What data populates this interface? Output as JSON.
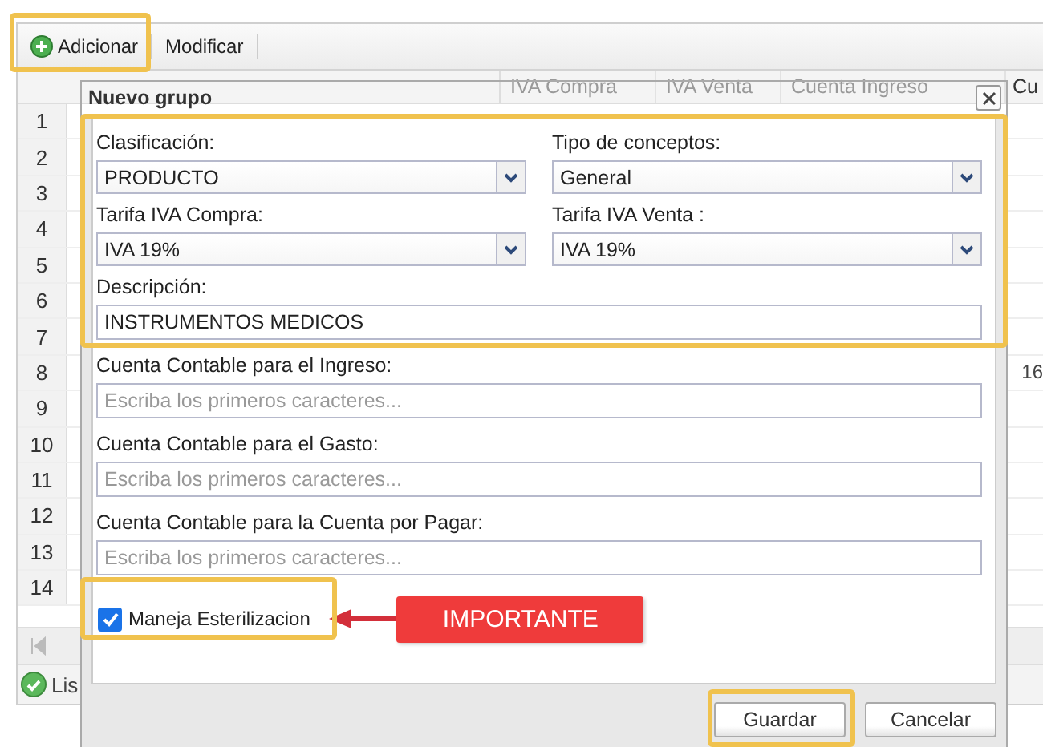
{
  "toolbar": {
    "buttons": [
      {
        "label": "Adicionar",
        "kind": "add"
      },
      {
        "label": "Modificar",
        "kind": "plain"
      }
    ]
  },
  "grid": {
    "columns": [
      "IVA Compra",
      "IVA Venta",
      "Cuenta Ingreso",
      "Cu"
    ],
    "rows": [
      {
        "number": "1"
      },
      {
        "number": "2"
      },
      {
        "number": "3"
      },
      {
        "number": "4"
      },
      {
        "number": "5"
      },
      {
        "number": "6"
      },
      {
        "number": "7"
      },
      {
        "number": "8",
        "tail": "16"
      },
      {
        "number": "9"
      },
      {
        "number": "10"
      },
      {
        "number": "11"
      },
      {
        "number": "12"
      },
      {
        "number": "13"
      },
      {
        "number": "14"
      }
    ]
  },
  "status_bar": {
    "text": "Lis"
  },
  "dialog": {
    "title": "Nuevo grupo",
    "fields": [
      {
        "kind": "select",
        "label": "Clasificación:",
        "value": "PRODUCTO",
        "half": true
      },
      {
        "kind": "select",
        "label": "Tipo de conceptos:",
        "value": "General",
        "half": true
      },
      {
        "kind": "select",
        "label": "Tarifa IVA Compra:",
        "value": "IVA 19%",
        "half": true
      },
      {
        "kind": "select",
        "label": "Tarifa IVA Venta :",
        "value": "IVA 19%",
        "half": true
      },
      {
        "kind": "text",
        "label": "Descripción:",
        "value": "INSTRUMENTOS MEDICOS",
        "half": false
      },
      {
        "kind": "text",
        "label": "Cuenta Contable para el Ingreso:",
        "placeholder": "Escriba los primeros caracteres...",
        "half": false
      },
      {
        "kind": "text",
        "label": "Cuenta Contable para el Gasto:",
        "placeholder": "Escriba los primeros caracteres...",
        "half": false
      },
      {
        "kind": "text",
        "label": "Cuenta Contable para la Cuenta por Pagar:",
        "placeholder": "Escriba los primeros caracteres...",
        "half": false
      }
    ],
    "checkbox": {
      "label": "Maneja Esterilizacion",
      "checked": true
    },
    "callout": "IMPORTANTE",
    "buttons": [
      {
        "label": "Guardar"
      },
      {
        "label": "Cancelar"
      }
    ]
  }
}
